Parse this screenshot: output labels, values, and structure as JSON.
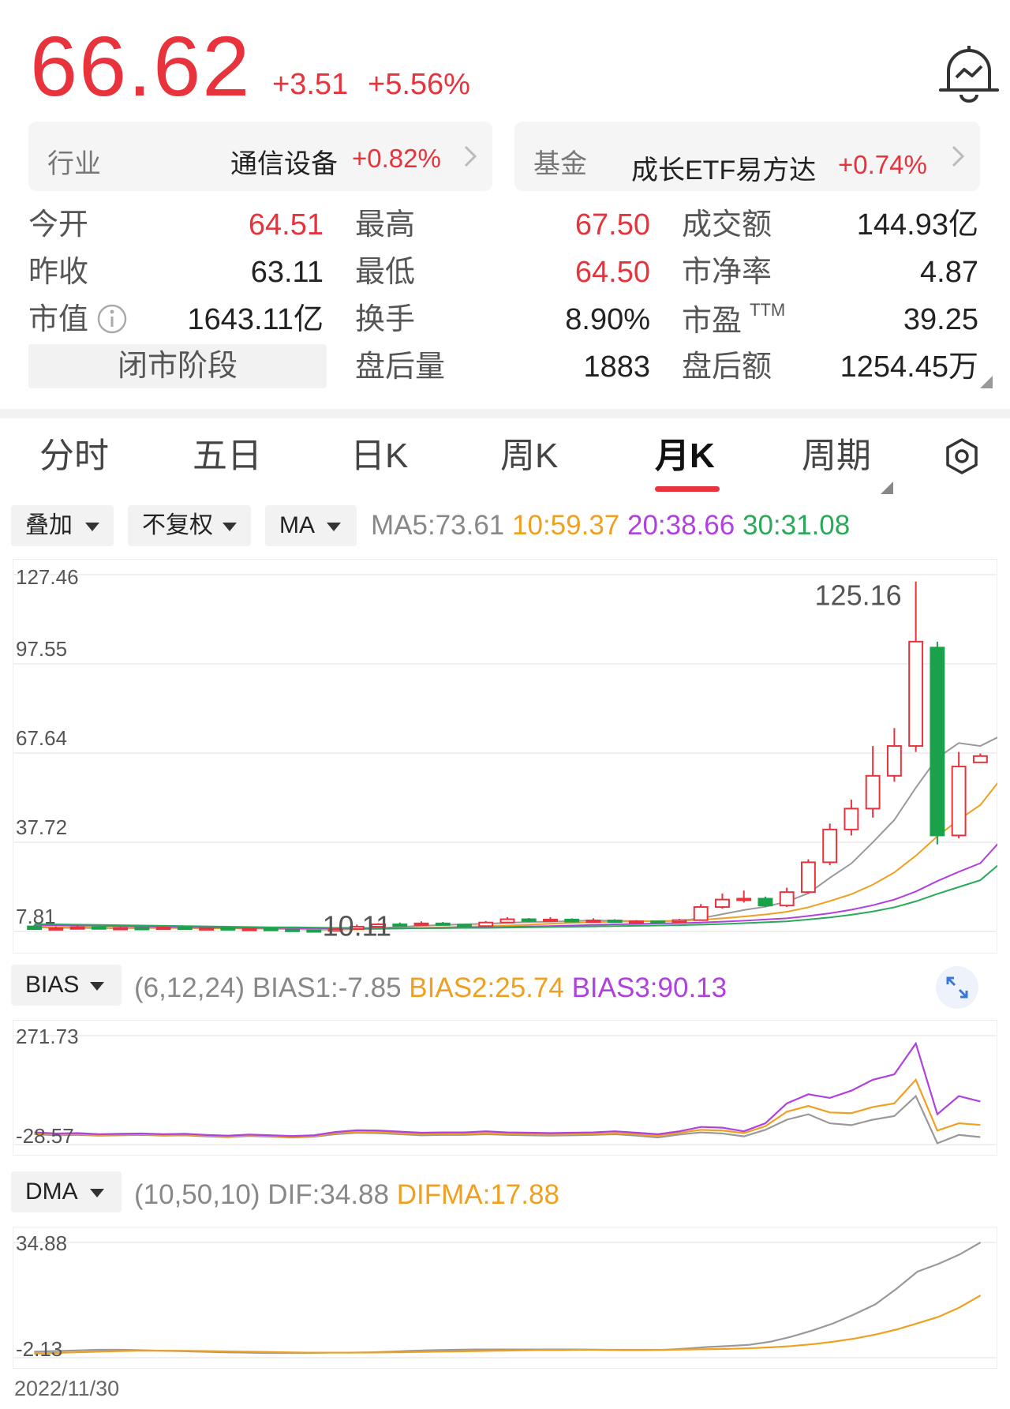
{
  "quote": {
    "price": "66.62",
    "change": "+3.51",
    "change_pct": "+5.56%"
  },
  "industry": {
    "label": "行业",
    "name": "通信设备",
    "pct": "+0.82%"
  },
  "fund": {
    "label": "基金",
    "name": "成长ETF易方达",
    "pct": "+0.74%"
  },
  "stats": {
    "open_label": "今开",
    "open": "64.51",
    "prev_label": "昨收",
    "prev": "63.11",
    "mcap_label": "市值",
    "mcap": "1643.11亿",
    "high_label": "最高",
    "high": "67.50",
    "low_label": "最低",
    "low": "64.50",
    "turnover_label": "换手",
    "turnover": "8.90%",
    "afterhours_vol_label": "盘后量",
    "afterhours_vol": "1883",
    "amount_label": "成交额",
    "amount": "144.93亿",
    "pb_label": "市净率",
    "pb": "4.87",
    "pe_label": "市盈",
    "pe_sup": "TTM",
    "pe": "39.25",
    "afterhours_amt_label": "盘后额",
    "afterhours_amt": "1254.45万",
    "phase": "闭市阶段"
  },
  "tabs": [
    "分时",
    "五日",
    "日K",
    "周K",
    "月K",
    "周期"
  ],
  "active_tab": "月K",
  "toolbar": {
    "overlay": "叠加",
    "adjust": "不复权",
    "indicator": "MA",
    "ma5": "MA5:73.61",
    "ma10": "10:59.37",
    "ma20": "20:38.66",
    "ma30": "30:31.08"
  },
  "colors": {
    "up": "#e8323c",
    "down": "#1aa24a",
    "ma5": "#999999",
    "ma10": "#f0a020",
    "ma20": "#b040e0",
    "ma30": "#2aaa58"
  },
  "bias_bar": {
    "selector": "BIAS",
    "params": "(6,12,24)",
    "bias1": "BIAS1:-7.85",
    "bias2": "BIAS2:25.74",
    "bias3": "BIAS3:90.13"
  },
  "dma_bar": {
    "selector": "DMA",
    "params": "(10,50,10)",
    "dif": "DIF:34.88",
    "difma": "DIFMA:17.88"
  },
  "footer_date": "2022/11/30",
  "chart_data": [
    {
      "type": "candlestick",
      "y_ticks": [
        "127.46",
        "97.55",
        "67.64",
        "37.72",
        "7.81"
      ],
      "ylim": [
        7.81,
        127.46
      ],
      "annotations": {
        "max": "125.16",
        "min": "10.11"
      },
      "candles": [
        {
          "o": 9.5,
          "c": 8.6,
          "h": 10.0,
          "l": 8.3
        },
        {
          "o": 8.7,
          "c": 8.9,
          "h": 9.5,
          "l": 8.4
        },
        {
          "o": 8.9,
          "c": 9.2,
          "h": 9.9,
          "l": 8.6
        },
        {
          "o": 9.2,
          "c": 8.8,
          "h": 9.6,
          "l": 8.5
        },
        {
          "o": 8.8,
          "c": 9.0,
          "h": 9.4,
          "l": 8.6
        },
        {
          "o": 9.0,
          "c": 8.9,
          "h": 9.3,
          "l": 8.7
        },
        {
          "o": 8.9,
          "c": 9.1,
          "h": 9.5,
          "l": 8.6
        },
        {
          "o": 9.1,
          "c": 8.8,
          "h": 9.4,
          "l": 8.5
        },
        {
          "o": 8.8,
          "c": 8.9,
          "h": 9.2,
          "l": 8.4
        },
        {
          "o": 8.9,
          "c": 8.6,
          "h": 9.1,
          "l": 8.3
        },
        {
          "o": 8.6,
          "c": 8.7,
          "h": 9.0,
          "l": 8.2
        },
        {
          "o": 8.7,
          "c": 8.4,
          "h": 8.9,
          "l": 8.1
        },
        {
          "o": 8.4,
          "c": 8.2,
          "h": 8.7,
          "l": 7.9
        },
        {
          "o": 8.2,
          "c": 8.0,
          "h": 8.5,
          "l": 7.8
        },
        {
          "o": 8.0,
          "c": 8.6,
          "h": 8.9,
          "l": 7.8
        },
        {
          "o": 8.6,
          "c": 9.4,
          "h": 10.11,
          "l": 8.4
        },
        {
          "o": 9.4,
          "c": 10.2,
          "h": 10.6,
          "l": 9.2
        },
        {
          "o": 10.2,
          "c": 10.0,
          "h": 10.8,
          "l": 9.7
        },
        {
          "o": 10.0,
          "c": 10.5,
          "h": 11.2,
          "l": 9.8
        },
        {
          "o": 10.5,
          "c": 10.1,
          "h": 11.0,
          "l": 9.8
        },
        {
          "o": 10.1,
          "c": 9.6,
          "h": 10.4,
          "l": 9.3
        },
        {
          "o": 9.6,
          "c": 10.8,
          "h": 11.3,
          "l": 9.5
        },
        {
          "o": 10.8,
          "c": 11.9,
          "h": 12.6,
          "l": 10.6
        },
        {
          "o": 11.9,
          "c": 11.3,
          "h": 12.3,
          "l": 11.0
        },
        {
          "o": 11.3,
          "c": 11.8,
          "h": 12.6,
          "l": 11.0
        },
        {
          "o": 11.8,
          "c": 11.1,
          "h": 12.2,
          "l": 10.9
        },
        {
          "o": 11.1,
          "c": 11.5,
          "h": 12.2,
          "l": 10.9
        },
        {
          "o": 11.5,
          "c": 11.0,
          "h": 11.9,
          "l": 10.7
        },
        {
          "o": 11.0,
          "c": 11.2,
          "h": 11.6,
          "l": 10.7
        },
        {
          "o": 11.2,
          "c": 11.0,
          "h": 11.5,
          "l": 10.7
        },
        {
          "o": 11.0,
          "c": 11.6,
          "h": 12.0,
          "l": 10.8
        },
        {
          "o": 11.6,
          "c": 16.0,
          "h": 17.0,
          "l": 11.4
        },
        {
          "o": 16.0,
          "c": 18.5,
          "h": 20.5,
          "l": 15.5
        },
        {
          "o": 18.5,
          "c": 18.8,
          "h": 21.5,
          "l": 17.5
        },
        {
          "o": 18.8,
          "c": 16.5,
          "h": 19.5,
          "l": 16.0
        },
        {
          "o": 16.5,
          "c": 21.0,
          "h": 22.5,
          "l": 16.0
        },
        {
          "o": 21.0,
          "c": 31.0,
          "h": 32.0,
          "l": 20.5
        },
        {
          "o": 31.0,
          "c": 42.0,
          "h": 44.0,
          "l": 30.0
        },
        {
          "o": 42.0,
          "c": 49.0,
          "h": 52.0,
          "l": 40.0
        },
        {
          "o": 49.0,
          "c": 60.0,
          "h": 70.0,
          "l": 46.0
        },
        {
          "o": 60.0,
          "c": 70.0,
          "h": 76.0,
          "l": 58.0
        },
        {
          "o": 70.0,
          "c": 105.0,
          "h": 125.16,
          "l": 68.0
        },
        {
          "o": 103.0,
          "c": 40.0,
          "h": 105.0,
          "l": 37.0
        },
        {
          "o": 40.0,
          "c": 63.11,
          "h": 68.0,
          "l": 39.0
        },
        {
          "o": 64.51,
          "c": 66.62,
          "h": 67.5,
          "l": 64.5
        }
      ],
      "ma": {
        "ma5": [
          9.2,
          9.0,
          9.0,
          8.9,
          8.9,
          8.9,
          9.0,
          8.9,
          8.9,
          8.8,
          8.8,
          8.7,
          8.6,
          8.4,
          8.4,
          8.6,
          8.9,
          9.3,
          9.7,
          10.0,
          10.2,
          10.4,
          10.7,
          11.0,
          11.1,
          11.3,
          11.5,
          11.4,
          11.3,
          11.2,
          11.4,
          12.2,
          13.6,
          15.0,
          16.1,
          17.8,
          20.6,
          25.8,
          30.6,
          37.7,
          45.2,
          56.0,
          66.0,
          71.0,
          70.0,
          73.61
        ],
        "ma10": [
          9.5,
          9.3,
          9.2,
          9.1,
          9.0,
          9.0,
          9.0,
          9.0,
          8.9,
          8.9,
          8.9,
          8.8,
          8.7,
          8.6,
          8.5,
          8.5,
          8.6,
          8.8,
          9.0,
          9.2,
          9.4,
          9.6,
          9.8,
          10.1,
          10.4,
          10.7,
          10.9,
          11.1,
          11.2,
          11.3,
          11.4,
          11.7,
          12.2,
          12.8,
          13.5,
          14.4,
          15.9,
          18.0,
          20.3,
          23.5,
          27.6,
          33.2,
          39.7,
          45.3,
          50.2,
          59.37
        ],
        "ma20": [
          10.0,
          9.9,
          9.8,
          9.7,
          9.6,
          9.5,
          9.4,
          9.3,
          9.2,
          9.1,
          9.0,
          9.0,
          8.9,
          8.9,
          8.8,
          8.8,
          8.8,
          8.8,
          8.9,
          9.0,
          9.1,
          9.2,
          9.3,
          9.5,
          9.6,
          9.8,
          10.0,
          10.2,
          10.3,
          10.5,
          10.6,
          10.8,
          11.1,
          11.4,
          11.8,
          12.2,
          13.0,
          13.9,
          15.1,
          16.6,
          18.5,
          21.2,
          24.7,
          27.8,
          30.7,
          38.66
        ],
        "ma30": [
          10.3,
          10.2,
          10.1,
          10.0,
          9.9,
          9.8,
          9.7,
          9.6,
          9.5,
          9.4,
          9.3,
          9.2,
          9.2,
          9.1,
          9.0,
          9.0,
          8.9,
          8.9,
          8.9,
          8.9,
          9.0,
          9.0,
          9.1,
          9.2,
          9.3,
          9.4,
          9.5,
          9.6,
          9.7,
          9.8,
          9.9,
          10.1,
          10.3,
          10.6,
          10.9,
          11.2,
          11.8,
          12.5,
          13.4,
          14.5,
          15.9,
          17.9,
          20.4,
          22.7,
          25.0,
          31.08
        ]
      }
    },
    {
      "type": "line",
      "y_ticks": [
        "271.73",
        "-28.57"
      ],
      "ylim": [
        -28.57,
        271.73
      ],
      "series": [
        {
          "name": "BIAS1",
          "values": [
            0,
            -3,
            -2,
            -4,
            -3,
            -2,
            -4,
            -3,
            -6,
            -8,
            -5,
            -7,
            -9,
            -7,
            0,
            4,
            3,
            0,
            -3,
            -2,
            -2,
            0,
            -2,
            -3,
            -4,
            -3,
            -2,
            0,
            -4,
            -9,
            -1,
            5,
            2,
            -6,
            12,
            40,
            55,
            30,
            25,
            40,
            50,
            105,
            -25,
            -2,
            -7.85
          ]
        },
        {
          "name": "BIAS2",
          "values": [
            2,
            -1,
            0,
            -2,
            -1,
            0,
            -2,
            -1,
            -4,
            -6,
            -3,
            -5,
            -7,
            -5,
            3,
            7,
            6,
            3,
            0,
            1,
            1,
            3,
            1,
            0,
            -1,
            0,
            1,
            3,
            0,
            -4,
            4,
            12,
            10,
            3,
            22,
            62,
            78,
            60,
            58,
            75,
            85,
            150,
            10,
            30,
            25.74
          ]
        },
        {
          "name": "BIAS3",
          "values": [
            5,
            2,
            3,
            0,
            1,
            2,
            0,
            1,
            -2,
            -4,
            -1,
            -3,
            -5,
            -3,
            6,
            11,
            10,
            7,
            4,
            5,
            5,
            8,
            5,
            4,
            3,
            4,
            5,
            8,
            4,
            0,
            8,
            20,
            18,
            8,
            30,
            85,
            110,
            100,
            120,
            150,
            165,
            250,
            55,
            105,
            90.13
          ]
        }
      ]
    },
    {
      "type": "line",
      "y_ticks": [
        "34.88",
        "-2.13"
      ],
      "ylim": [
        -2.13,
        34.88
      ],
      "x_label": "2022/11/30",
      "series": [
        {
          "name": "DIF",
          "values": [
            -0.2,
            0,
            0.2,
            0.4,
            0.4,
            0.3,
            0.1,
            0,
            -0.2,
            -0.4,
            -0.5,
            -0.6,
            -0.6,
            -0.6,
            -0.5,
            -0.5,
            -0.4,
            -0.2,
            0.1,
            0.3,
            0.4,
            0.5,
            0.5,
            0.5,
            0.5,
            0.5,
            0.5,
            0.4,
            0.3,
            0.3,
            0.4,
            0.8,
            1.3,
            1.6,
            2.0,
            3.0,
            4.6,
            6.6,
            8.9,
            11.8,
            15.0,
            20.0,
            25.5,
            28.0,
            31.0,
            34.88
          ]
        },
        {
          "name": "DIFMA",
          "values": [
            -0.8,
            -0.6,
            -0.4,
            -0.2,
            0,
            0.1,
            0.1,
            0.1,
            0,
            -0.1,
            -0.2,
            -0.3,
            -0.4,
            -0.5,
            -0.5,
            -0.5,
            -0.5,
            -0.4,
            -0.3,
            -0.2,
            -0.1,
            0,
            0.1,
            0.2,
            0.3,
            0.3,
            0.4,
            0.4,
            0.4,
            0.4,
            0.4,
            0.5,
            0.6,
            0.7,
            0.9,
            1.2,
            1.6,
            2.2,
            3.0,
            4.0,
            5.3,
            6.9,
            8.9,
            11.0,
            14.0,
            17.88
          ]
        }
      ]
    }
  ]
}
